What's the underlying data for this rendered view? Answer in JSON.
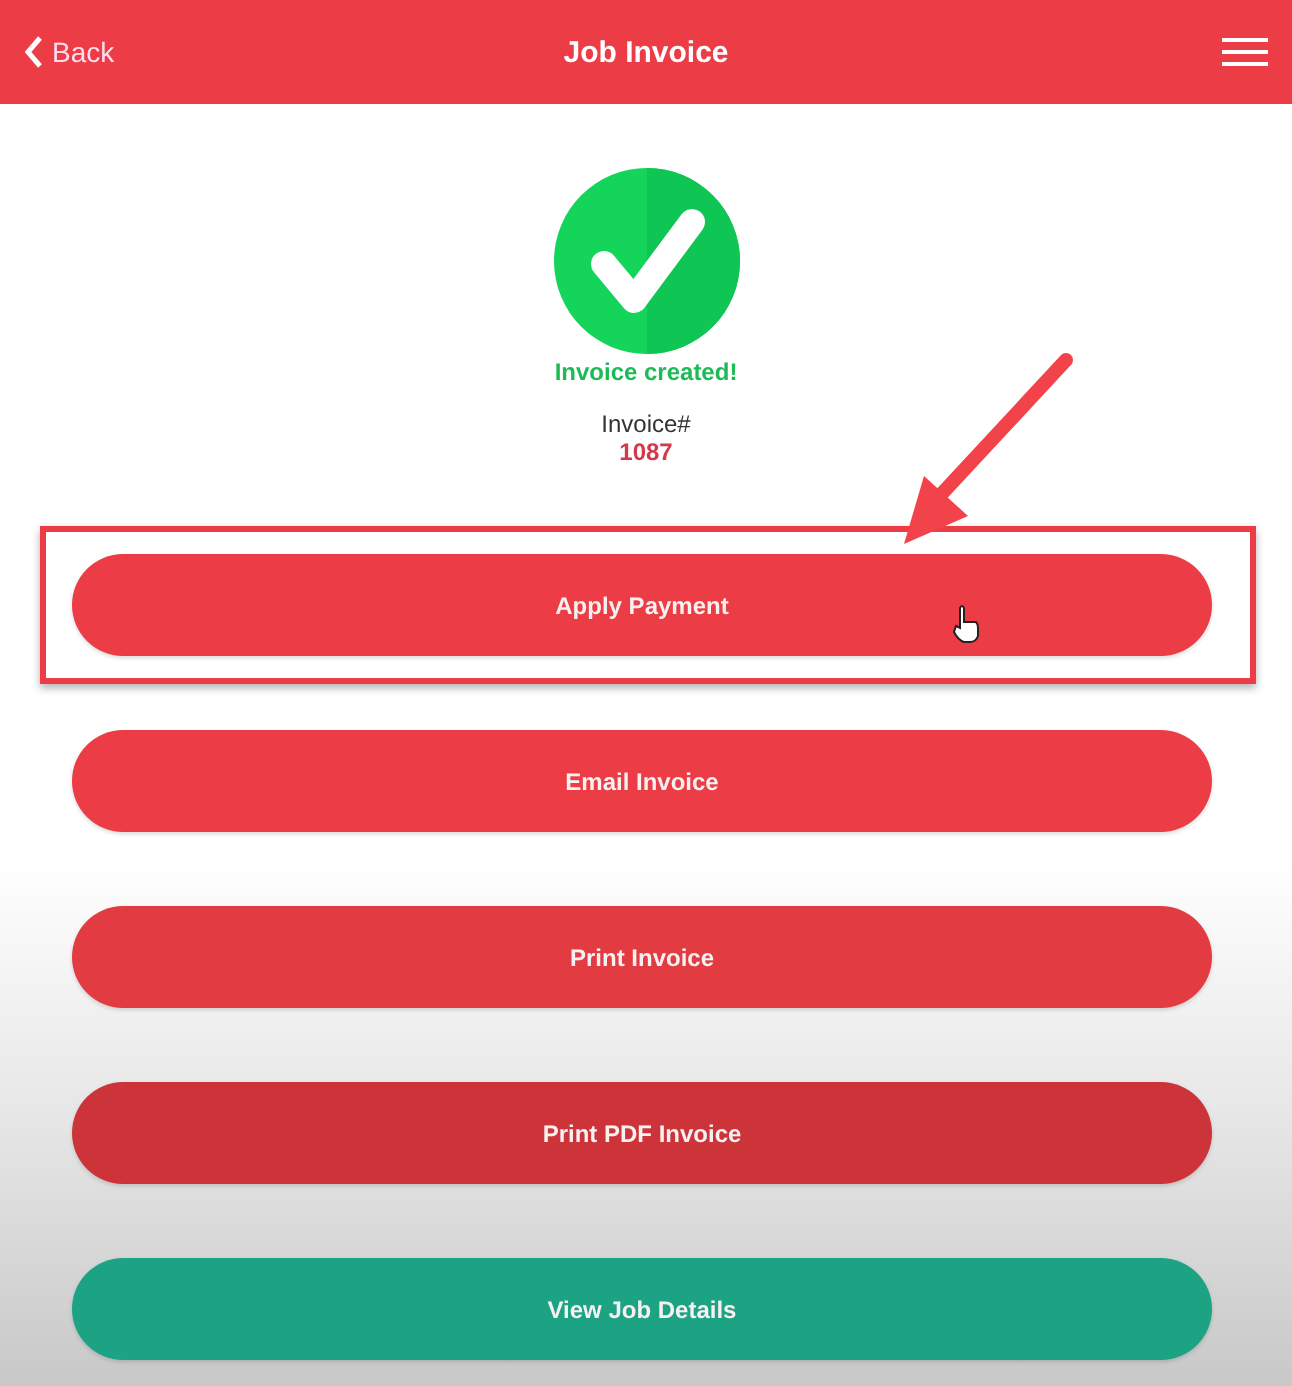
{
  "header": {
    "back": "Back",
    "title": "Job Invoice"
  },
  "status": {
    "message": "Invoice created!",
    "label": "Invoice#",
    "number": "1087"
  },
  "buttons": [
    {
      "label": "Apply Payment",
      "color": "#ec3c45",
      "highlighted": true
    },
    {
      "label": "Email Invoice",
      "color": "#ec3c45",
      "highlighted": false
    },
    {
      "label": "Print Invoice",
      "color": "#e33b42",
      "highlighted": false
    },
    {
      "label": "Print PDF Invoice",
      "color": "#cc343a",
      "highlighted": false
    },
    {
      "label": "View Job Details",
      "color": "#1ba384",
      "highlighted": false
    }
  ]
}
